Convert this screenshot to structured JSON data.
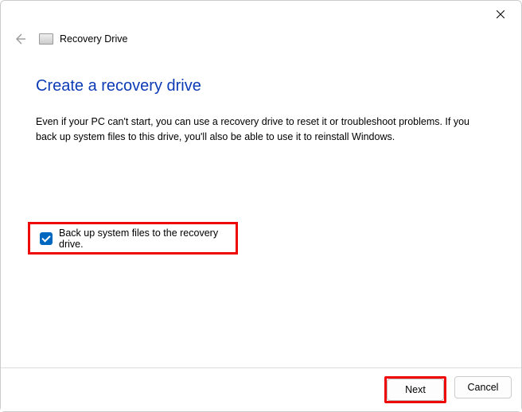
{
  "window": {
    "title": "Recovery Drive"
  },
  "page": {
    "heading": "Create a recovery drive",
    "description": "Even if your PC can't start, you can use a recovery drive to reset it or troubleshoot problems. If you back up system files to this drive, you'll also be able to use it to reinstall Windows."
  },
  "checkbox": {
    "label": "Back up system files to the recovery drive.",
    "checked": true
  },
  "buttons": {
    "next": "Next",
    "cancel": "Cancel"
  }
}
